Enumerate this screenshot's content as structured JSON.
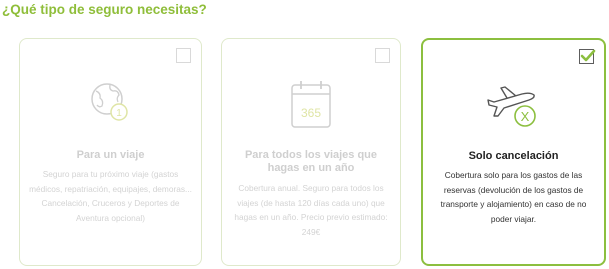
{
  "heading": "¿Qué tipo de seguro necesitas?",
  "colors": {
    "accent": "#8fbe3a",
    "inactive_border": "#dfe9cb",
    "active_border": "#8cbf3f",
    "inactive_text": "#cfcfcf",
    "active_text": "#222222"
  },
  "cards": [
    {
      "title": "Para un viaje",
      "description": "Seguro para tu próximo viaje (gastos médicos, repatriación, equipajes, demoras... Cancelación, Cruceros y Deportes de Aventura opcional)",
      "icon": "globe-one-icon",
      "badge": "1",
      "selected": false
    },
    {
      "title": "Para todos los viajes que hagas en un año",
      "description": "Cobertura anual. Seguro para todos los viajes (de hasta 120 días cada uno) que hagas en un año. Precio previo estimado: 249€",
      "icon": "calendar-365-icon",
      "badge": "365",
      "selected": false
    },
    {
      "title": "Solo cancelación",
      "description": "Cobertura solo para los gastos de las reservas (devolución de los gastos de transporte y alojamiento) en caso de no poder viajar.",
      "icon": "plane-cancel-icon",
      "badge": "X",
      "selected": true
    }
  ]
}
